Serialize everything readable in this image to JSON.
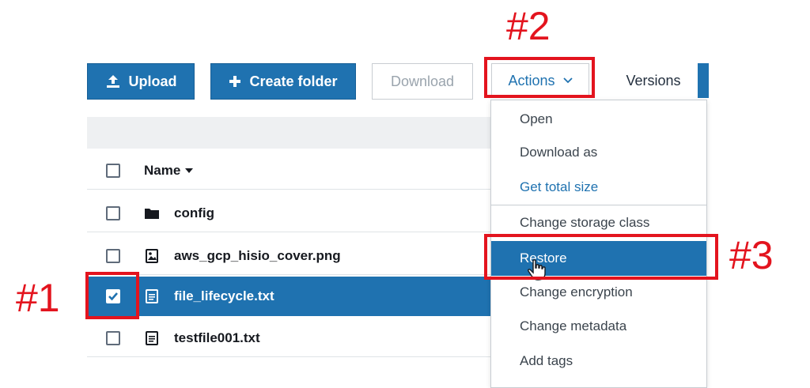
{
  "toolbar": {
    "upload_label": "Upload",
    "create_folder_label": "Create folder",
    "download_label": "Download",
    "actions_label": "Actions",
    "versions_label": "Versions"
  },
  "table": {
    "name_header": "Name",
    "rows": [
      {
        "name": "config",
        "type": "folder",
        "selected": false
      },
      {
        "name": "aws_gcp_hisio_cover.png",
        "type": "image",
        "selected": false
      },
      {
        "name": "file_lifecycle.txt",
        "type": "text-file",
        "selected": true
      },
      {
        "name": "testfile001.txt",
        "type": "text-file",
        "selected": false
      }
    ]
  },
  "actions_menu": {
    "items": [
      {
        "label": "Open"
      },
      {
        "label": "Download as"
      },
      {
        "label": "Get total size"
      },
      {
        "label": "Change storage class"
      },
      {
        "label": "Restore"
      },
      {
        "label": "Change encryption"
      },
      {
        "label": "Change metadata"
      },
      {
        "label": "Add tags"
      }
    ]
  },
  "annotations": {
    "label_1": "#1",
    "label_2": "#2",
    "label_3": "#3"
  },
  "colors": {
    "primary_blue": "#1f72b0",
    "annotation_red": "#e3141e"
  },
  "icons": {
    "upload": "upload-icon",
    "create_folder": "plus-icon",
    "actions_caret": "chevron-down-icon",
    "sort_caret": "caret-down-icon",
    "folder": "folder-icon",
    "image": "image-file-icon",
    "text_file": "text-file-icon",
    "cursor": "hand-pointer-icon"
  }
}
